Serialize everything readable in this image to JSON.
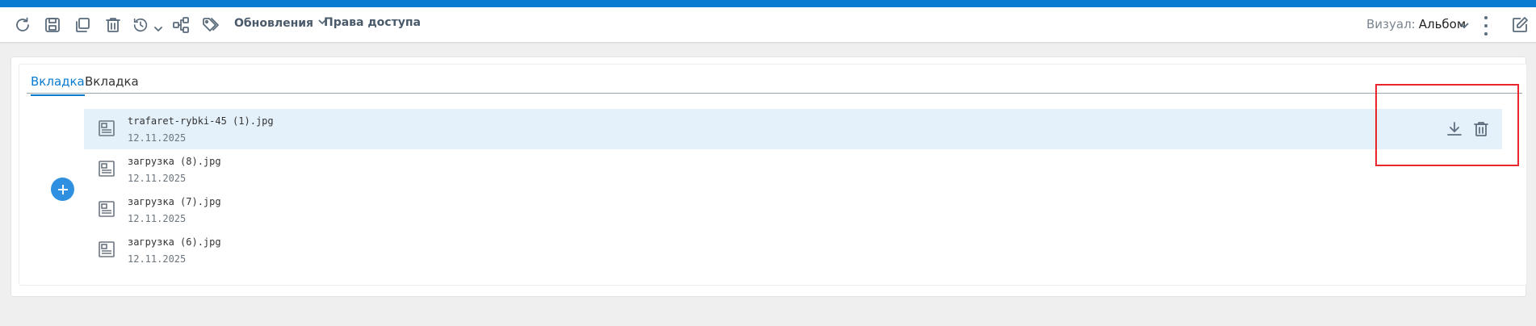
{
  "colors": {
    "accent": "#0a7bd0",
    "add_button": "#2f8fe0",
    "selected_row": "#e4f0fa",
    "highlight": "#e8262b"
  },
  "toolbar": {
    "icons": [
      "refresh-icon",
      "save-icon",
      "copy-icon",
      "trash-icon",
      "history-icon",
      "share-tree-icon",
      "tags-icon"
    ],
    "updates_label": "Обновления",
    "access_label": "Права доступа",
    "visual_label": "Визуал:",
    "visual_value": "Альбом"
  },
  "tabs": [
    {
      "label": "Вкладка",
      "active": true
    },
    {
      "label": "Вкладка",
      "active": false
    }
  ],
  "files": [
    {
      "name": "trafaret-rybki-45 (1).jpg",
      "date": "12.11.2025",
      "selected": true
    },
    {
      "name": "загрузка (8).jpg",
      "date": "12.11.2025",
      "selected": false
    },
    {
      "name": "загрузка (7).jpg",
      "date": "12.11.2025",
      "selected": false
    },
    {
      "name": "загрузка (6).jpg",
      "date": "12.11.2025",
      "selected": false
    }
  ]
}
